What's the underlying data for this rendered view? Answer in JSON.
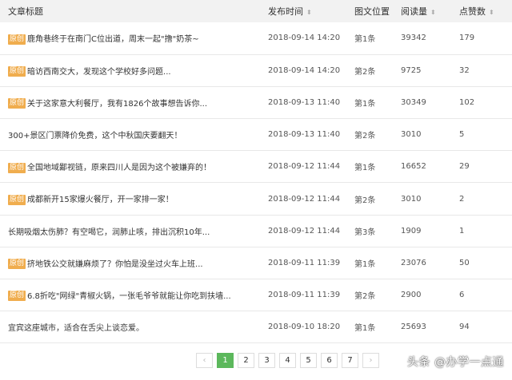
{
  "table": {
    "headers": {
      "title": "文章标题",
      "publish_time": "发布时间",
      "position": "图文位置",
      "reads": "阅读量",
      "likes": "点赞数"
    },
    "badge": "原创",
    "rows": [
      {
        "badge": true,
        "title": "鹿角巷终于在南门C位出道，周末一起\"撸\"奶茶~",
        "time": "2018-09-14 14:20",
        "position": "第1条",
        "reads": "39342",
        "likes": "179"
      },
      {
        "badge": true,
        "title": "暗访西南交大，发现这个学校好多问题...",
        "time": "2018-09-14 14:20",
        "position": "第2条",
        "reads": "9725",
        "likes": "32"
      },
      {
        "badge": true,
        "title": "关于这家意大利餐厅，我有1826个故事想告诉你...",
        "time": "2018-09-13 11:40",
        "position": "第1条",
        "reads": "30349",
        "likes": "102"
      },
      {
        "badge": false,
        "title": "300+景区门票降价免费，这个中秋国庆要翻天！",
        "time": "2018-09-13 11:40",
        "position": "第2条",
        "reads": "3010",
        "likes": "5"
      },
      {
        "badge": true,
        "title": "全国地域鄙视链，原来四川人是因为这个被嫌弃的！",
        "time": "2018-09-12 11:44",
        "position": "第1条",
        "reads": "16652",
        "likes": "29"
      },
      {
        "badge": true,
        "title": "成都新开15家爆火餐厅，开一家排一家！",
        "time": "2018-09-12 11:44",
        "position": "第2条",
        "reads": "3010",
        "likes": "2"
      },
      {
        "badge": false,
        "title": "长期吸烟太伤肺？有空喝它，润肺止咳，排出沉积10年...",
        "time": "2018-09-12 11:44",
        "position": "第3条",
        "reads": "1909",
        "likes": "1"
      },
      {
        "badge": true,
        "title": "挤地铁公交就嫌麻烦了？你怕是没坐过火车上班...",
        "time": "2018-09-11 11:39",
        "position": "第1条",
        "reads": "23076",
        "likes": "50"
      },
      {
        "badge": true,
        "title": "6.8折吃\"网绿\"青椒火锅，一张毛爷爷就能让你吃到扶墙...",
        "time": "2018-09-11 11:39",
        "position": "第2条",
        "reads": "2900",
        "likes": "6"
      },
      {
        "badge": false,
        "title": "宜宾这座城市，适合在舌尖上谈恋爱。",
        "time": "2018-09-10 18:20",
        "position": "第1条",
        "reads": "25693",
        "likes": "94"
      }
    ]
  },
  "pagination": {
    "prev": "‹",
    "pages": [
      "1",
      "2",
      "3",
      "4",
      "5",
      "6",
      "7"
    ],
    "active": "1",
    "next": "›"
  },
  "watermark": "头条 @办学一点通",
  "colors": {
    "badge": "#f0ad4e",
    "active_page": "#5cb85c",
    "header_bg": "#f2f2f2"
  }
}
